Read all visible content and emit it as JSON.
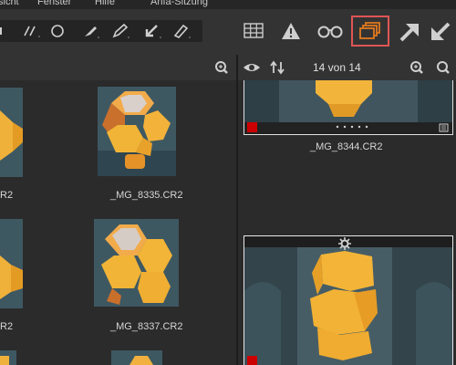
{
  "menu": {
    "items": [
      "sicht",
      "Fenster",
      "Hilfe",
      "Anfa-Sitzung"
    ]
  },
  "toolbar": {
    "tools": [
      "lasso-tool",
      "line-tool",
      "ellipse-tool",
      "brush-tool",
      "pen-tool",
      "arrow-tool",
      "eraser-tool"
    ],
    "buttons": [
      "grid-view-icon",
      "warning-icon",
      "glasses-icon",
      "stack-icon",
      "arrow-up-right-icon",
      "arrow-down-left-icon"
    ],
    "active_button": "stack-icon",
    "accent_color": "#e07a1e",
    "active_outline_color": "#e05555"
  },
  "browser": {
    "captions": [
      "R2",
      "_MG_8335.CR2",
      "R2",
      "_MG_8337.CR2"
    ]
  },
  "filmstrip": {
    "counter": "14 von 14",
    "captions": [
      "_MG_8344.CR2"
    ],
    "label_color": "#cc0000"
  }
}
